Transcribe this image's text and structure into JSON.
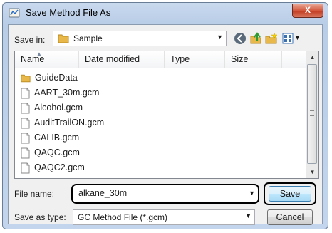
{
  "window": {
    "title": "Save Method File As",
    "close_glyph": "X"
  },
  "toolbar": {
    "save_in_label": "Save in:",
    "location": "Sample",
    "icons": [
      "back-icon",
      "up-folder-icon",
      "new-folder-icon",
      "view-menu-icon"
    ]
  },
  "file_list": {
    "columns": [
      "Name",
      "Date modified",
      "Type",
      "Size"
    ],
    "items": [
      {
        "name": "GuideData",
        "kind": "folder"
      },
      {
        "name": "AART_30m.gcm",
        "kind": "file"
      },
      {
        "name": "Alcohol.gcm",
        "kind": "file"
      },
      {
        "name": "AuditTrailON.gcm",
        "kind": "file"
      },
      {
        "name": "CALIB.gcm",
        "kind": "file"
      },
      {
        "name": "QAQC.gcm",
        "kind": "file"
      },
      {
        "name": "QAQC2.gcm",
        "kind": "file"
      }
    ]
  },
  "form": {
    "file_name_label": "File name:",
    "file_name_value": "alkane_30m",
    "save_as_type_label": "Save as type:",
    "save_as_type_value": "GC Method File (*.gcm)"
  },
  "buttons": {
    "save": "Save",
    "cancel": "Cancel"
  },
  "colors": {
    "title_bar": "#c2d5ec",
    "close_button": "#c23a1f",
    "folder": "#e8b84a",
    "accent": "#3c7fb1"
  }
}
